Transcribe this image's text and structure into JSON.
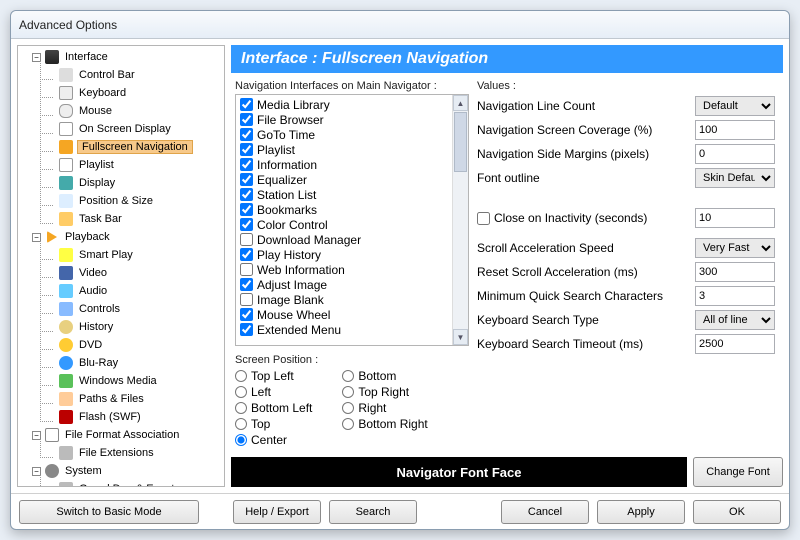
{
  "window": {
    "title": "Advanced Options"
  },
  "sidebar": {
    "nodes": [
      {
        "label": "Interface",
        "level": 1,
        "icon": "i-interface",
        "expandable": true
      },
      {
        "label": "Control Bar",
        "level": 2,
        "icon": "i-control"
      },
      {
        "label": "Keyboard",
        "level": 2,
        "icon": "i-kbd"
      },
      {
        "label": "Mouse",
        "level": 2,
        "icon": "i-mouse"
      },
      {
        "label": "On Screen Display",
        "level": 2,
        "icon": "i-osd"
      },
      {
        "label": "Fullscreen Navigation",
        "level": 2,
        "icon": "i-cross",
        "selected": true
      },
      {
        "label": "Playlist",
        "level": 2,
        "icon": "i-playlist"
      },
      {
        "label": "Display",
        "level": 2,
        "icon": "i-display"
      },
      {
        "label": "Position & Size",
        "level": 2,
        "icon": "i-pos"
      },
      {
        "label": "Task Bar",
        "level": 2,
        "icon": "i-task"
      },
      {
        "label": "Playback",
        "level": 1,
        "icon": "i-play",
        "expandable": true
      },
      {
        "label": "Smart Play",
        "level": 2,
        "icon": "i-smart"
      },
      {
        "label": "Video",
        "level": 2,
        "icon": "i-video"
      },
      {
        "label": "Audio",
        "level": 2,
        "icon": "i-audio"
      },
      {
        "label": "Controls",
        "level": 2,
        "icon": "i-controls"
      },
      {
        "label": "History",
        "level": 2,
        "icon": "i-history"
      },
      {
        "label": "DVD",
        "level": 2,
        "icon": "i-dvd"
      },
      {
        "label": "Blu-Ray",
        "level": 2,
        "icon": "i-bluray"
      },
      {
        "label": "Windows Media",
        "level": 2,
        "icon": "i-wm"
      },
      {
        "label": "Paths & Files",
        "level": 2,
        "icon": "i-paths"
      },
      {
        "label": "Flash (SWF)",
        "level": 2,
        "icon": "i-flash"
      },
      {
        "label": "File Format Association",
        "level": 1,
        "icon": "i-doc",
        "expandable": true
      },
      {
        "label": "File Extensions",
        "level": 2,
        "icon": "i-ext"
      },
      {
        "label": "System",
        "level": 1,
        "icon": "i-gear",
        "expandable": true
      },
      {
        "label": "Guard Dog & Events",
        "level": 2,
        "icon": "i-ext"
      }
    ]
  },
  "header": {
    "title": "Interface : Fullscreen Navigation"
  },
  "navInterfaces": {
    "label": "Navigation Interfaces on Main Navigator :",
    "items": [
      {
        "label": "Media Library",
        "checked": true
      },
      {
        "label": "File Browser",
        "checked": true
      },
      {
        "label": "GoTo Time",
        "checked": true
      },
      {
        "label": "Playlist",
        "checked": true
      },
      {
        "label": "Information",
        "checked": true
      },
      {
        "label": "Equalizer",
        "checked": true
      },
      {
        "label": "Station List",
        "checked": true
      },
      {
        "label": "Bookmarks",
        "checked": true
      },
      {
        "label": "Color Control",
        "checked": true
      },
      {
        "label": "Download Manager",
        "checked": false
      },
      {
        "label": "Play History",
        "checked": true
      },
      {
        "label": "Web Information",
        "checked": false
      },
      {
        "label": "Adjust Image",
        "checked": true
      },
      {
        "label": "Image Blank",
        "checked": false
      },
      {
        "label": "Mouse Wheel",
        "checked": true
      },
      {
        "label": "Extended Menu",
        "checked": true
      }
    ]
  },
  "screenPosition": {
    "label": "Screen Position :",
    "col1": [
      "Top Left",
      "Left",
      "Bottom Left",
      "Top",
      "Center"
    ],
    "col2": [
      "Bottom",
      "Top Right",
      "Right",
      "Bottom Right"
    ],
    "selected": "Center"
  },
  "values": {
    "label": "Values :",
    "rows": [
      {
        "label": "Navigation Line Count",
        "type": "select",
        "value": "Default"
      },
      {
        "label": "Navigation Screen Coverage (%)",
        "type": "text",
        "value": "100"
      },
      {
        "label": "Navigation Side Margins (pixels)",
        "type": "text",
        "value": "0"
      },
      {
        "label": "Font outline",
        "type": "select",
        "value": "Skin Default"
      }
    ],
    "closeInactivity": {
      "label": "Close on Inactivity (seconds)",
      "checked": false,
      "value": "10"
    },
    "rows2": [
      {
        "label": "Scroll Acceleration Speed",
        "type": "select",
        "value": "Very Fast"
      },
      {
        "label": "Reset Scroll Acceleration (ms)",
        "type": "text",
        "value": "300"
      },
      {
        "label": "Minimum Quick Search Characters",
        "type": "text",
        "value": "3"
      },
      {
        "label": "Keyboard Search Type",
        "type": "select",
        "value": "All of line"
      },
      {
        "label": "Keyboard Search Timeout (ms)",
        "type": "text",
        "value": "2500"
      }
    ]
  },
  "fontbar": {
    "label": "Navigator Font Face",
    "button": "Change Font"
  },
  "footer": {
    "basic": "Switch to Basic Mode",
    "help": "Help / Export",
    "search": "Search",
    "cancel": "Cancel",
    "apply": "Apply",
    "ok": "OK"
  }
}
